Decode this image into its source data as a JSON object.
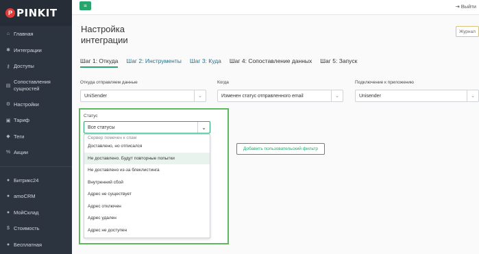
{
  "brand": {
    "logo_text": "PINKIT",
    "logo_mark": "P"
  },
  "sidebar": {
    "items": [
      {
        "label": "Главная",
        "icon": "home-icon",
        "glyph": "⌂"
      },
      {
        "label": "Интеграции",
        "icon": "integrations-icon",
        "glyph": "✱"
      },
      {
        "label": "Доступы",
        "icon": "key-icon",
        "glyph": "⚷"
      },
      {
        "label": "Сопоставления сущностей",
        "icon": "mapping-icon",
        "glyph": "▤"
      },
      {
        "label": "Настройки",
        "icon": "gear-icon",
        "glyph": "⚙"
      },
      {
        "label": "Тариф",
        "icon": "cart-icon",
        "glyph": "▣"
      },
      {
        "label": "Теги",
        "icon": "tag-icon",
        "glyph": "◆"
      },
      {
        "label": "Акции",
        "icon": "percent-icon",
        "glyph": "%"
      }
    ],
    "apps": [
      {
        "label": "Битрикс24",
        "icon": "app-dot-icon",
        "glyph": "●"
      },
      {
        "label": "amoCRM",
        "icon": "app-dot-icon",
        "glyph": "●"
      },
      {
        "label": "МойСклад",
        "icon": "app-dot-icon",
        "glyph": "●"
      },
      {
        "label": "Стоимость",
        "icon": "dollar-icon",
        "glyph": "$"
      },
      {
        "label": "Бесплатная",
        "icon": "app-dot-icon",
        "glyph": "●"
      }
    ]
  },
  "topbar": {
    "menu_glyph": "≡",
    "logout_label": "Выйти",
    "logout_glyph": "⇥"
  },
  "page": {
    "title": "Настройка интеграции",
    "journal_label": "Журнал"
  },
  "steps": [
    {
      "label": "Шаг 1: Откуда",
      "state": "active"
    },
    {
      "label": "Шаг 2: Инструменты",
      "state": "link"
    },
    {
      "label": "Шаг 3: Куда",
      "state": "link"
    },
    {
      "label": "Шаг 4: Сопоставление данных",
      "state": "plain"
    },
    {
      "label": "Шаг 5: Запуск",
      "state": "plain"
    }
  ],
  "fields": {
    "source": {
      "label": "Откуда отправляем данные",
      "value": "UniSender"
    },
    "when": {
      "label": "Когда",
      "value": "Изменен статус отправленного email"
    },
    "connection": {
      "label": "Подключение к приложению",
      "value": "Unisender"
    }
  },
  "status": {
    "label": "Статус",
    "value": "Все статусы",
    "options": [
      "Сервер помечен к спам",
      "Доставлено, но отписался",
      "Не доставлено. Будут повторные попытки",
      "Не доставлено из-за блеклистинга",
      "Внутренний сбой",
      "Адрес не существует",
      "Адрес отключен",
      "Адрес удален",
      "Адрес не доступен"
    ],
    "highlighted_index": 2
  },
  "filter_button_label": "Добавить пользовательский фильтр",
  "colors": {
    "accent": "#27a56c",
    "sidebar": "#2c3440",
    "logo_red": "#e23b3b"
  }
}
